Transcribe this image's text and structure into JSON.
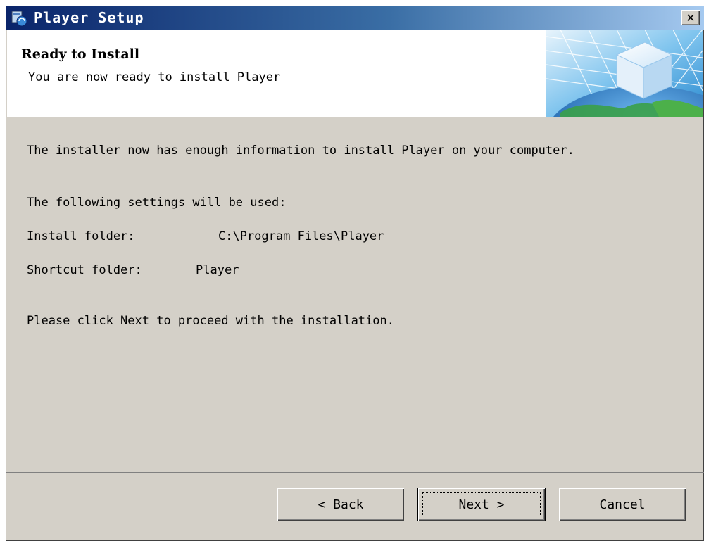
{
  "window": {
    "title": "Player Setup",
    "close_glyph": "✕",
    "icon": "installer-icon"
  },
  "header": {
    "title": "Ready to Install",
    "subtitle": "You are now ready to install Player",
    "graphic": "globe-cube-graphic"
  },
  "content": {
    "intro": "The installer now has enough information to install Player on your computer.",
    "settings_heading": "The following settings will be used:",
    "settings": [
      {
        "label": "Install folder:",
        "value": "C:\\Program Files\\Player"
      },
      {
        "label": "Shortcut folder:",
        "value": "Player"
      }
    ],
    "instruction": "Please click Next to proceed with the installation."
  },
  "buttons": {
    "back": "< Back",
    "next": "Next >",
    "cancel": "Cancel"
  }
}
